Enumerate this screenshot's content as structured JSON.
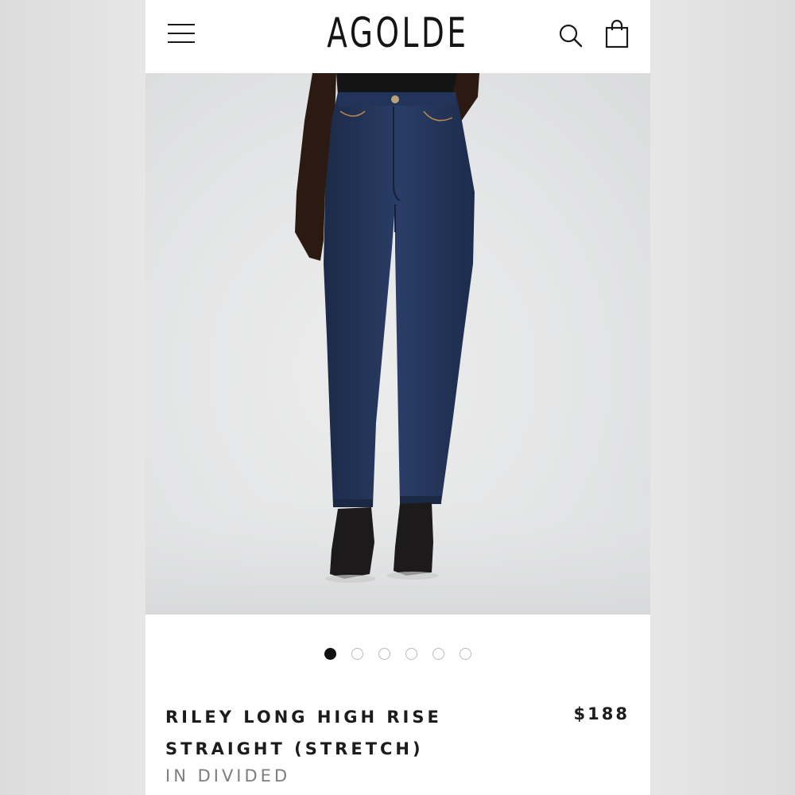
{
  "header": {
    "brand": "AGOLDE",
    "menu_icon": "hamburger-menu-icon",
    "search_icon": "search-icon",
    "bag_icon": "shopping-bag-icon"
  },
  "gallery": {
    "image_count": 6,
    "active_index": 0
  },
  "product": {
    "title": "RILEY LONG HIGH RISE STRAIGHT (STRETCH)",
    "price": "$188",
    "variant": "IN DIVIDED"
  },
  "colors": {
    "denim": "#22345a",
    "text": "#1c1c1c",
    "muted": "#7d7d7d"
  }
}
